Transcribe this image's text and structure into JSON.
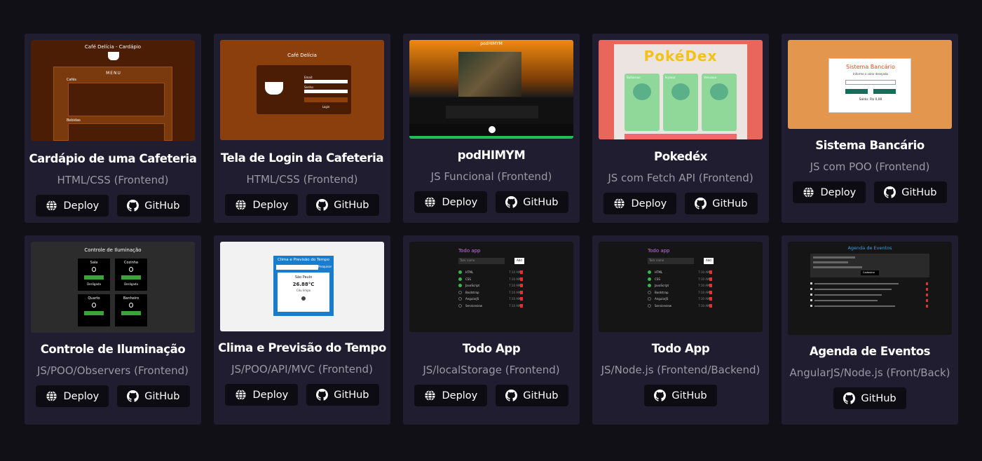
{
  "projects": [
    {
      "title": "Cardápio de uma Cafeteria",
      "tech": "HTML/CSS (Frontend)",
      "deploy": "Deploy",
      "github": "GitHub",
      "thumb": {
        "heading": "Café Delícia - Cardápio",
        "menu": "MENU",
        "sec1": "Cafés",
        "sec2": "Bebidas"
      }
    },
    {
      "title": "Tela de Login da Cafeteria",
      "tech": "HTML/CSS (Frontend)",
      "deploy": "Deploy",
      "github": "GitHub",
      "thumb": {
        "heading": "Café Delícia",
        "user_label": "Email:",
        "pass_label": "Senha:",
        "login": "Login"
      }
    },
    {
      "title": "podHIMYM",
      "tech": "JS Funcional (Frontend)",
      "deploy": "Deploy",
      "github": "GitHub",
      "thumb": {
        "heading": "podHIMYM"
      }
    },
    {
      "title": "Pokedéx",
      "tech": "JS com Fetch API (Frontend)",
      "deploy": "Deploy",
      "github": "GitHub",
      "thumb": {
        "logo": "PokéDex",
        "p1": "Bulbasaur",
        "p2": "Ivysaur",
        "p3": "Venusaur"
      }
    },
    {
      "title": "Sistema Bancário",
      "tech": "JS com POO (Frontend)",
      "deploy": "Deploy",
      "github": "GitHub",
      "thumb": {
        "heading": "Sistema Bancário",
        "sub": "Informe o valor desejado",
        "dep": "Depositar",
        "sac": "Sacar",
        "saldo": "Saldo: R$ 0,00"
      }
    },
    {
      "title": "Controle de Iluminação",
      "tech": "JS/POO/Observers (Frontend)",
      "deploy": "Deploy",
      "github": "GitHub",
      "thumb": {
        "heading": "Controle de Iluminação",
        "rooms": [
          "Sala",
          "Cozinha",
          "Quarto",
          "Banheiro"
        ],
        "on": "Ligar/Desligar",
        "off": "Desligada"
      }
    },
    {
      "title": "Clima e Previsão do Tempo",
      "tech": "JS/POO/API/MVC (Frontend)",
      "deploy": "Deploy",
      "github": "GitHub",
      "thumb": {
        "heading": "Clima e Previsão do Tempo",
        "search": "Pesquisar",
        "city": "São Paulo",
        "temp": "26.88°C",
        "cond": "Céu limpo"
      }
    },
    {
      "title": "Todo App",
      "tech": "JS/localStorage (Frontend)",
      "deploy": "Deploy",
      "github": "GitHub",
      "thumb": {
        "heading": "Todo app",
        "placeholder": "Task name",
        "add": "Add",
        "tasks": [
          "HTML",
          "CSS",
          "JavaScript",
          "Bootstrap",
          "AngularJS",
          "Serviceview"
        ],
        "time": "7:10 AM"
      }
    },
    {
      "title": "Todo App",
      "tech": "JS/Node.js (Frontend/Backend)",
      "deploy": null,
      "github": "GitHub",
      "thumb": {
        "heading": "Todo app",
        "placeholder": "Task name",
        "add": "Add",
        "tasks": [
          "HTML",
          "CSS",
          "JavaScript",
          "Bootstrap",
          "AngularJS",
          "Serviceview"
        ],
        "time": "7:10 AM"
      }
    },
    {
      "title": "Agenda de Eventos",
      "tech": "AngularJS/Node.js (Front/Back)",
      "deploy": null,
      "github": "GitHub",
      "thumb": {
        "heading": "Agenda de Eventos",
        "btn": "Cadastrar"
      }
    }
  ],
  "colors": {
    "page_bg": "#111017",
    "card_bg": "#211d30",
    "button_bg": "#0d0c12",
    "muted_text": "#9a98a6"
  },
  "icons": {
    "deploy": "globe-icon",
    "github": "github-icon"
  }
}
